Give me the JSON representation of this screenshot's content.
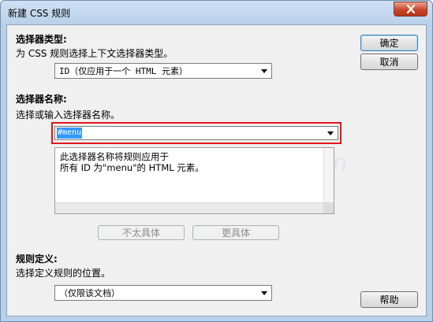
{
  "window": {
    "title": "新建 CSS 规则",
    "close_icon": "close-icon"
  },
  "selector_type": {
    "heading": "选择器类型:",
    "description": "为 CSS 规则选择上下文选择器类型。",
    "selected": "ID（仅应用于一个 HTML 元素）"
  },
  "selector_name": {
    "heading": "选择器名称:",
    "description": "选择或输入选择器名称。",
    "value": "#menu",
    "info_line1": "此选择器名称将规则应用于",
    "info_line2": "所有 ID 为\"menu\"的 HTML 元素。",
    "less_specific_label": "不太具体",
    "more_specific_label": "更具体"
  },
  "rule_definition": {
    "heading": "规则定义:",
    "description": "选择定义规则的位置。",
    "selected": "（仅限该文档）"
  },
  "buttons": {
    "ok": "确定",
    "cancel": "取消",
    "help": "帮助"
  },
  "watermark": "www.aa25.cn",
  "colors": {
    "highlight_border": "#e0151b",
    "selection": "#3399ff"
  }
}
